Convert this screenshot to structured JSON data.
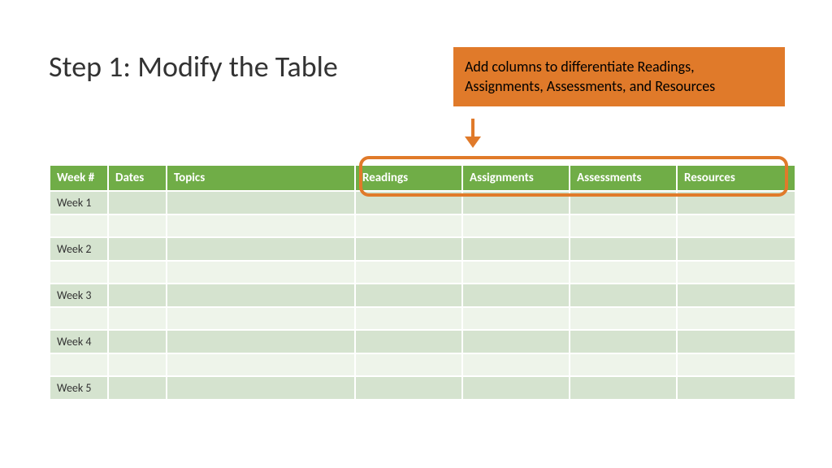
{
  "title": "Step 1: Modify the Table",
  "callout": "Add columns to differentiate Readings, Assignments, Assessments, and Resources",
  "table": {
    "headers": {
      "week": "Week #",
      "dates": "Dates",
      "topics": "Topics",
      "readings": "Readings",
      "assignments": "Assignments",
      "assessments": "Assessments",
      "resources": "Resources"
    },
    "rows": [
      {
        "week": "Week 1"
      },
      {
        "week": ""
      },
      {
        "week": "Week 2"
      },
      {
        "week": ""
      },
      {
        "week": "Week 3"
      },
      {
        "week": ""
      },
      {
        "week": "Week 4"
      },
      {
        "week": ""
      },
      {
        "week": "Week 5"
      }
    ]
  },
  "colors": {
    "accent_orange": "#e07a2a",
    "header_green": "#70ad47",
    "band_dark": "#d5e3cf",
    "band_light": "#eef4ea"
  }
}
